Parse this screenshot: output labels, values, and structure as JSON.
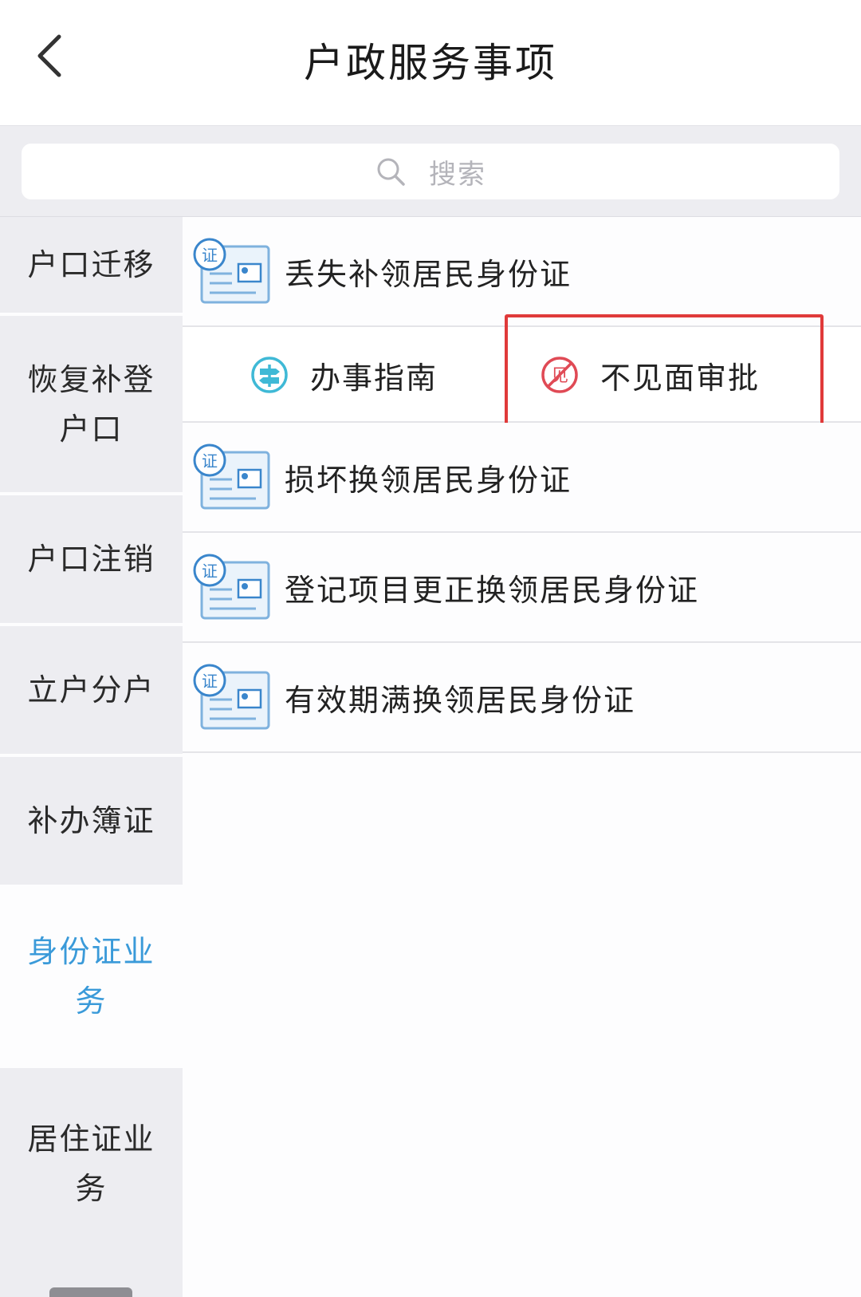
{
  "header": {
    "title": "户政服务事项",
    "back_icon": "chevron-left-icon"
  },
  "search": {
    "placeholder": "搜索",
    "icon": "search-icon"
  },
  "sidebar": {
    "items": [
      {
        "lines": [
          "户口迁移"
        ]
      },
      {
        "lines": [
          "恢复补登",
          "户口"
        ]
      },
      {
        "lines": [
          "户口注销"
        ]
      },
      {
        "lines": [
          "立户分户"
        ]
      },
      {
        "lines": [
          "补办簿证"
        ]
      },
      {
        "lines": [
          "身份证业",
          "务"
        ],
        "active": true
      },
      {
        "lines": [
          "居住证业",
          "务"
        ]
      }
    ]
  },
  "list": {
    "items": [
      {
        "label": "丢失补领居民身份证",
        "icon": "id-card-icon",
        "icon_text": "证"
      },
      {
        "label": "损坏换领居民身份证",
        "icon": "id-card-icon",
        "icon_text": "证"
      },
      {
        "label": "登记项目更正换领居民身份证",
        "icon": "id-card-icon",
        "icon_text": "证"
      },
      {
        "label": "有效期满换领居民身份证",
        "icon": "id-card-icon",
        "icon_text": "证"
      }
    ],
    "actions": {
      "guide_label": "办事指南",
      "guide_icon": "signpost-icon",
      "no_meet_label": "不见面审批",
      "no_meet_icon": "no-meeting-icon",
      "no_meet_icon_text": "见"
    }
  },
  "colors": {
    "accent": "#3a9ad9",
    "highlight": "#e03a3a",
    "sidebar_bg": "#ededf1",
    "guide_icon": "#3fb9d6",
    "no_meet_icon": "#e04a55"
  }
}
